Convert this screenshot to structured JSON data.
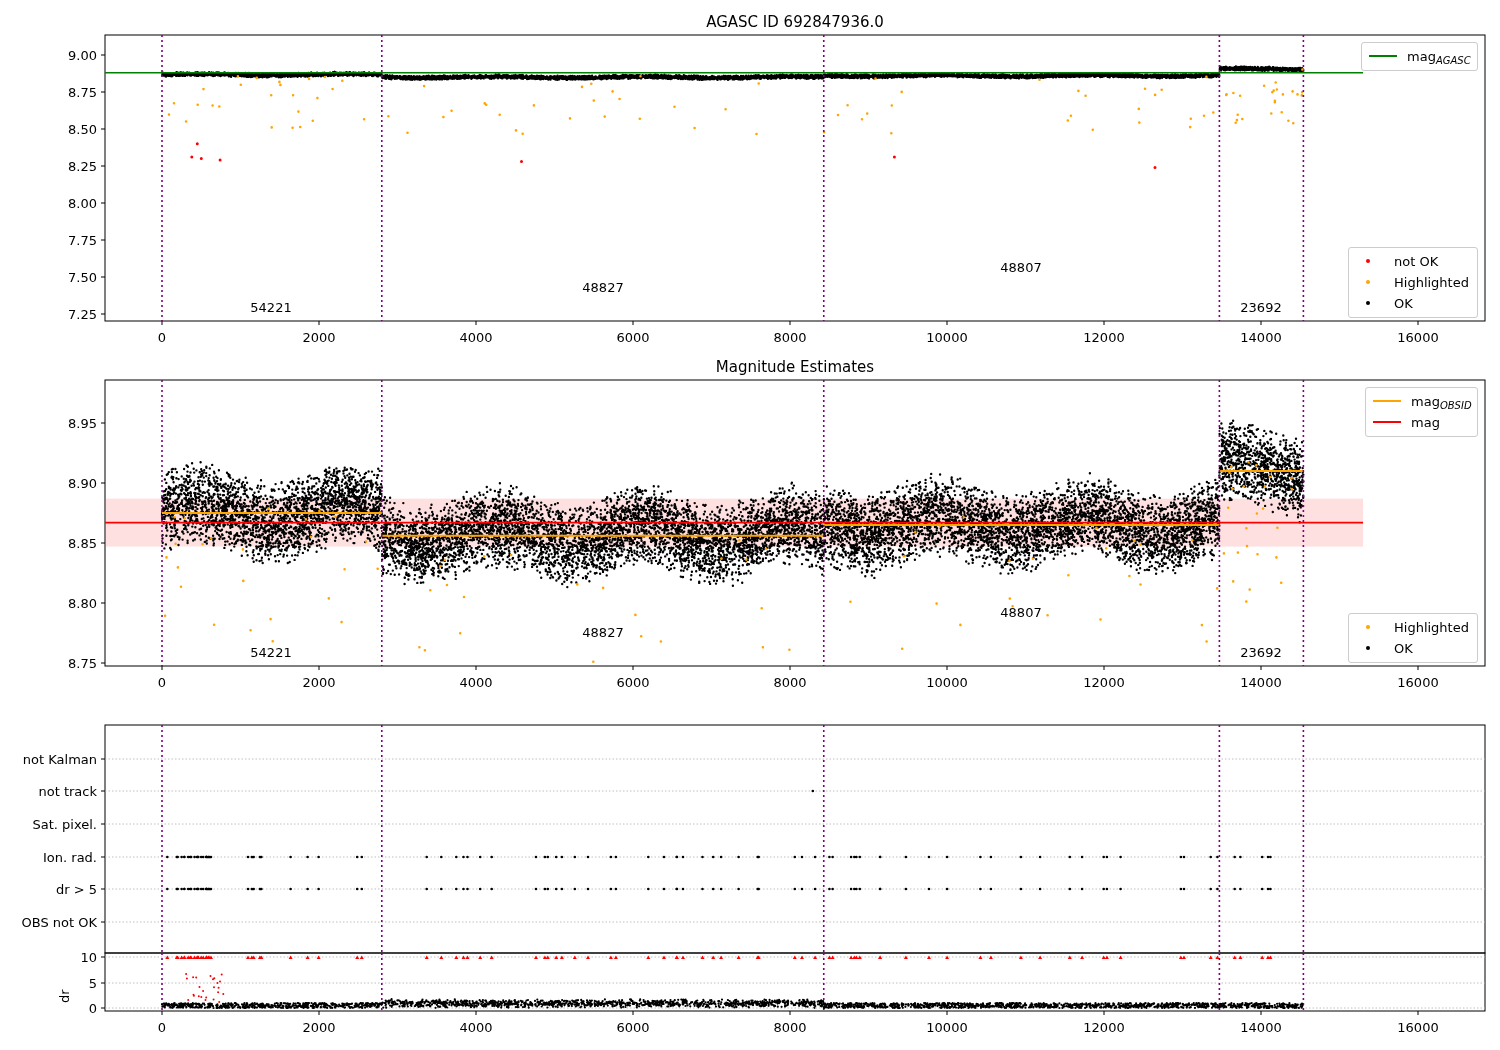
{
  "panels": [
    {
      "kind": "scatter",
      "title": "AGASC ID 692847936.0",
      "yticks": [
        "9.00",
        "8.75",
        "8.50",
        "8.25",
        "8.00",
        "7.75",
        "7.50",
        "7.25"
      ],
      "xticks": [
        "0",
        "2000",
        "4000",
        "6000",
        "8000",
        "10000",
        "12000",
        "14000",
        "16000"
      ],
      "segment_labels": [
        "54221",
        "48827",
        "48807",
        "23692"
      ],
      "legends": [
        {
          "items": [
            {
              "kind": "line",
              "label": "mag$_{AGASC}$",
              "color": "#008000"
            }
          ]
        },
        {
          "items": [
            {
              "kind": "dot",
              "label": "not OK",
              "color": "#ff0000"
            },
            {
              "kind": "dot",
              "label": "Highlighted",
              "color": "#ffa500"
            },
            {
              "kind": "dot",
              "label": "OK",
              "color": "#000000"
            }
          ]
        }
      ]
    },
    {
      "kind": "scatter",
      "title": "Magnitude Estimates",
      "yticks": [
        "8.95",
        "8.90",
        "8.85",
        "8.80",
        "8.75"
      ],
      "xticks": [
        "0",
        "2000",
        "4000",
        "6000",
        "8000",
        "10000",
        "12000",
        "14000",
        "16000"
      ],
      "segment_labels": [
        "54221",
        "48827",
        "48807",
        "23692"
      ],
      "legends": [
        {
          "items": [
            {
              "kind": "line",
              "label": "mag$_{OBSID}$",
              "color": "#ffa500"
            },
            {
              "kind": "line",
              "label": "mag",
              "color": "#ff0000"
            }
          ]
        },
        {
          "items": [
            {
              "kind": "dot",
              "label": "Highlighted",
              "color": "#ffa500"
            },
            {
              "kind": "dot",
              "label": "OK",
              "color": "#000000"
            }
          ]
        }
      ]
    },
    {
      "kind": "flags",
      "rows": [
        "not Kalman",
        "not track",
        "Sat. pixel.",
        "Ion. rad.",
        "dr > 5",
        "OBS not OK"
      ]
    },
    {
      "kind": "dr",
      "ylabel": "dr",
      "yticks": [
        "10",
        "5",
        "0"
      ],
      "xticks": [
        "0",
        "2000",
        "4000",
        "6000",
        "8000",
        "10000",
        "12000",
        "14000",
        "16000"
      ]
    }
  ]
}
